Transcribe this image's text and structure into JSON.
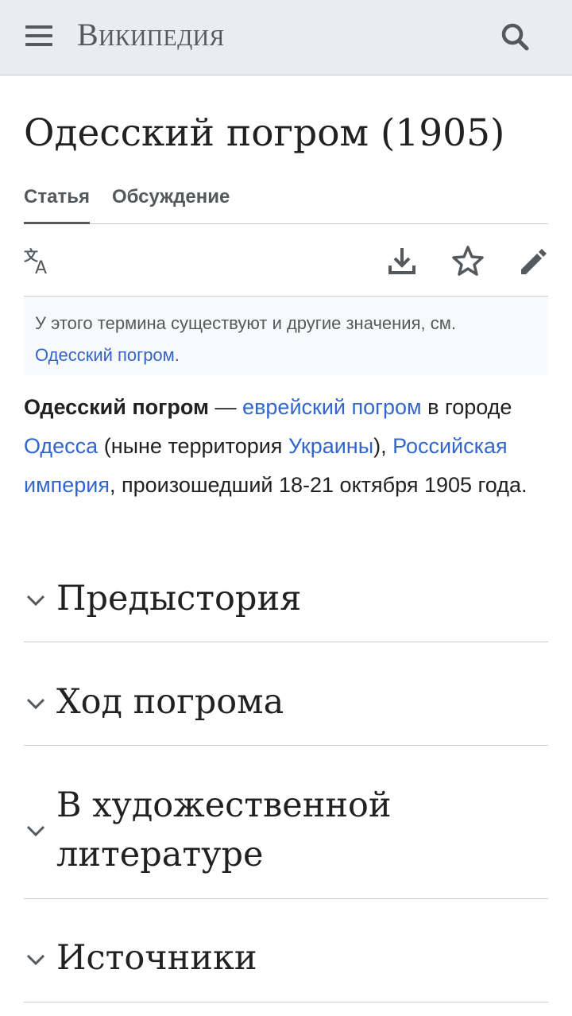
{
  "header": {
    "logo_text": "Википедия",
    "menu_icon": "hamburger-menu-icon",
    "search_icon": "search-icon"
  },
  "article": {
    "title": "Одесский погром (1905)"
  },
  "tabs": [
    {
      "label": "Статья",
      "active": true
    },
    {
      "label": "Обсуждение",
      "active": false
    }
  ],
  "toolbar": {
    "icons": [
      "language-icon",
      "download-icon",
      "star-icon",
      "edit-pencil-icon"
    ]
  },
  "hatnote": {
    "text": "У этого термина существуют и другие значения, см.",
    "link": "Одесский погром",
    "trail": "."
  },
  "lead": {
    "bold": "Одесский погром",
    "t1": " — ",
    "link1": "еврейский погром",
    "t2": " в городе ",
    "link2": "Одесса",
    "t3": " (ныне территория ",
    "link3": "Украины",
    "t4": "), ",
    "link4": "Российская империя",
    "t5": ", произошедший 18-21 октября 1905 года."
  },
  "sections": [
    {
      "title": "Предыстория"
    },
    {
      "title": "Ход погрома"
    },
    {
      "title": "В художественной литературе"
    },
    {
      "title": "Источники"
    }
  ],
  "colors": {
    "link": "#3366cc",
    "header_bg": "#eaecf0",
    "text": "#202122",
    "icon": "#54595d"
  }
}
